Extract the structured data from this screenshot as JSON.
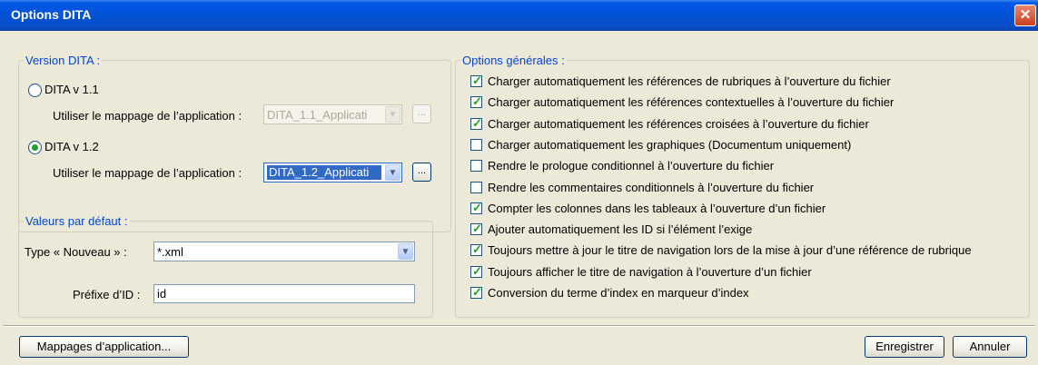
{
  "window": {
    "title": "Options DITA",
    "close_icon": "close-icon",
    "close_symbol": "✕"
  },
  "version_group": {
    "legend": "Version DITA :",
    "options": [
      {
        "label": "DITA v 1.1",
        "selected": false,
        "mapping_label": "Utiliser le mappage de l’application :",
        "mapping_value": "DITA_1.1_Applicati",
        "enabled": false
      },
      {
        "label": "DITA v 1.2",
        "selected": true,
        "mapping_label": "Utiliser le mappage de l’application :",
        "mapping_value": "DITA_1.2_Applicati",
        "enabled": true
      }
    ],
    "browse_label": "..."
  },
  "defaults_group": {
    "legend": "Valeurs par défaut :",
    "type_label": "Type « Nouveau » :",
    "type_value": "*.xml",
    "prefix_label": "Préfixe d’ID :",
    "prefix_value": "id"
  },
  "general_options": {
    "legend": "Options générales :",
    "items": [
      {
        "label": "Charger automatiquement les références de rubriques à l’ouverture du fichier",
        "checked": true
      },
      {
        "label": "Charger automatiquement les références contextuelles à l’ouverture du fichier",
        "checked": true
      },
      {
        "label": "Charger automatiquement les références croisées à l’ouverture du fichier",
        "checked": true
      },
      {
        "label": "Charger automatiquement les graphiques (Documentum uniquement)",
        "checked": false
      },
      {
        "label": "Rendre le prologue conditionnel à l’ouverture du fichier",
        "checked": false
      },
      {
        "label": "Rendre les commentaires conditionnels à l’ouverture du fichier",
        "checked": false
      },
      {
        "label": "Compter les colonnes dans les tableaux à l’ouverture d’un fichier",
        "checked": true
      },
      {
        "label": "Ajouter automatiquement les ID si l’élément l’exige",
        "checked": true
      },
      {
        "label": "Toujours mettre à jour le titre de navigation lors de la mise à jour d’une référence de rubrique",
        "checked": true
      },
      {
        "label": "Toujours afficher le titre de navigation à l’ouverture d’un fichier",
        "checked": true
      },
      {
        "label": "Conversion du terme d’index en marqueur d’index",
        "checked": true
      }
    ]
  },
  "buttons": {
    "mappings": "Mappages d’application...",
    "save": "Enregistrer",
    "cancel": "Annuler"
  },
  "icons": {
    "dropdown_symbol": "▼",
    "check_symbol": "✓"
  }
}
